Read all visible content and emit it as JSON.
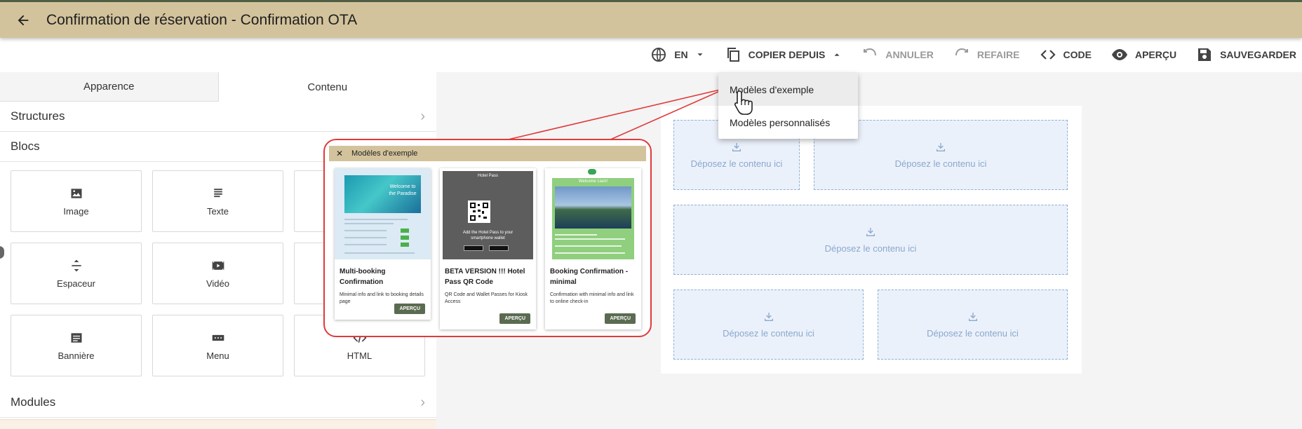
{
  "header": {
    "title": "Confirmation de réservation - Confirmation OTA"
  },
  "toolbar": {
    "language": "EN",
    "copy_from": "COPIER DEPUIS",
    "undo": "ANNULER",
    "redo": "REFAIRE",
    "code": "CODE",
    "preview": "APERÇU",
    "save": "SAUVEGARDER"
  },
  "copy_menu": {
    "items": [
      "Modèles d'exemple",
      "Modèles personnalisés"
    ]
  },
  "left_panel": {
    "tabs": [
      "Apparence",
      "Contenu"
    ],
    "sections": {
      "structures": "Structures",
      "blocs": "Blocs",
      "modules": "Modules"
    },
    "blocks": [
      "Image",
      "Texte",
      "",
      "Espaceur",
      "Vidéo",
      "",
      "Bannière",
      "Menu",
      "HTML"
    ]
  },
  "canvas": {
    "drop_label": "Déposez le contenu ici"
  },
  "templates_dialog": {
    "title": "Modèles d'exemple",
    "cards": [
      {
        "title": "Multi-booking Confirmation",
        "desc": "Minimal info and link to booking details page",
        "button": "APERÇU",
        "thumb_text": "Welcome to the Paradise"
      },
      {
        "title": "BETA VERSION !!! Hotel Pass QR Code",
        "desc": "QR Code and Wallet Passes for Kiosk Access",
        "button": "APERÇU",
        "thumb_title": "Hotel Pass",
        "thumb_text": "Add the Hotel Pass to your smartphone wallet"
      },
      {
        "title": "Booking Confirmation - minimal",
        "desc": "Confirmation with minimal info and link to online check-in",
        "button": "APERÇU",
        "thumb_text": "Welcome Liam!"
      }
    ]
  },
  "colors": {
    "header": "#d3c39c",
    "accent_button": "#5b6b51",
    "callout": "#e03a3a",
    "drop_zone": "#ebf1fa"
  }
}
